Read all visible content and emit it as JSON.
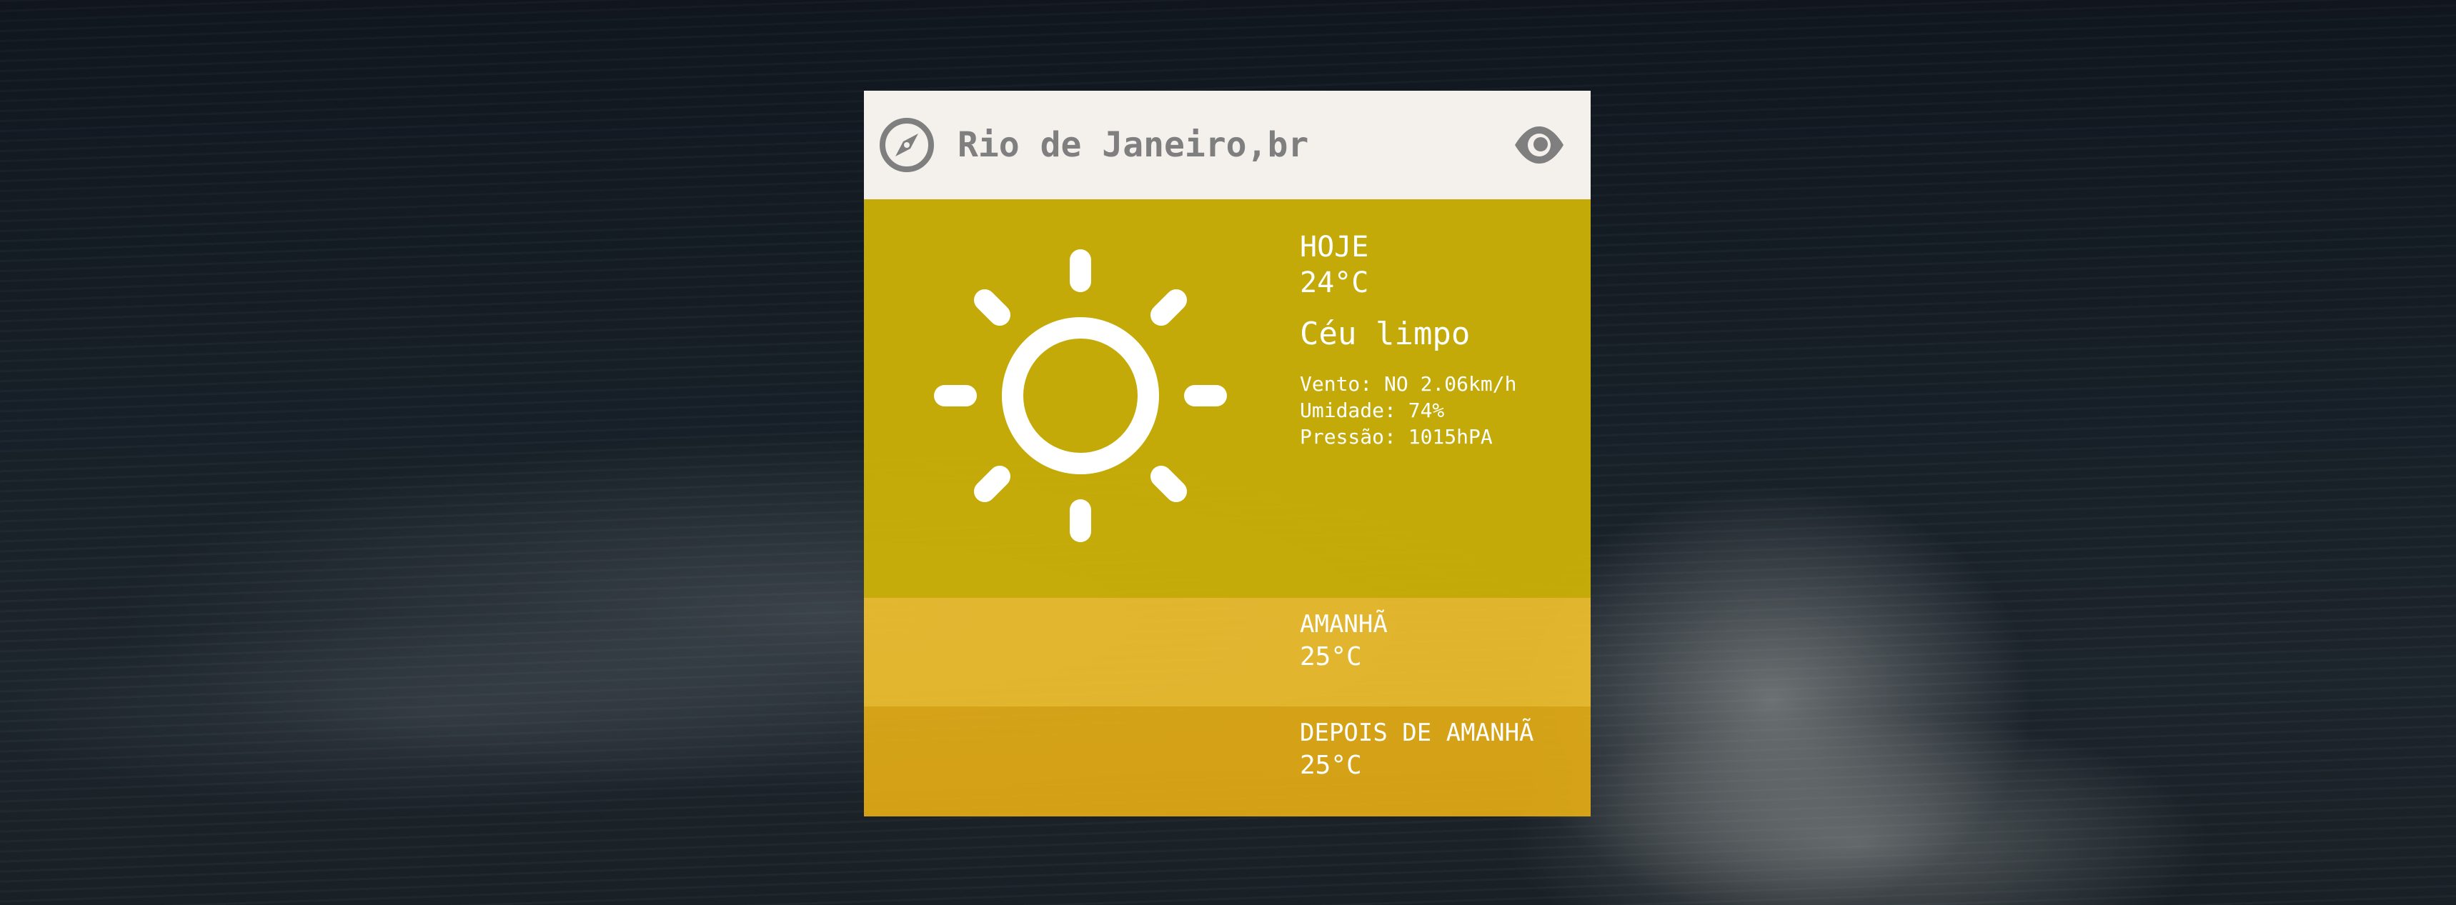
{
  "header": {
    "city": "Rio de Janeiro,br",
    "location_icon": "compass-icon",
    "toggle_icon": "eye-icon"
  },
  "today": {
    "label": "HOJE",
    "temperature": "24°C",
    "description": "Céu limpo",
    "icon": "sun-icon",
    "wind": "Vento: NO 2.06km/h",
    "humidity": "Umidade: 74%",
    "pressure": "Pressão: 1015hPA"
  },
  "forecast": [
    {
      "label": "AMANHÃ",
      "temperature": "25°C"
    },
    {
      "label": "DEPOIS DE AMANHÃ",
      "temperature": "25°C"
    }
  ],
  "colors": {
    "header_bg": "#f4f1ed",
    "today_bg": "#d1b506",
    "tomorrow_bg": "#f0bf2e",
    "after_bg": "#e2ab16",
    "header_text": "#7f7f7f",
    "text": "#ffffff"
  }
}
